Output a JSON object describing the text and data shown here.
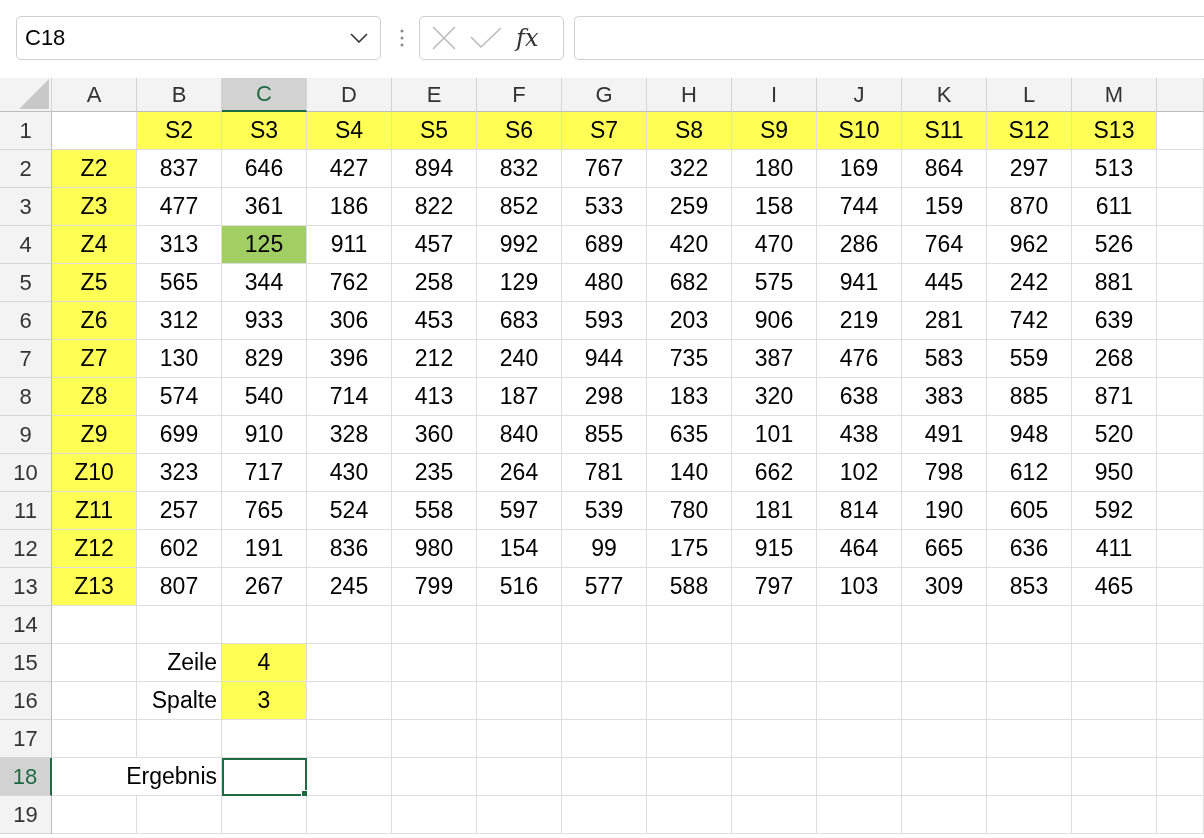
{
  "name_box": {
    "value": "C18"
  },
  "formula_bar": {
    "function_label": "fx"
  },
  "columns": [
    {
      "label": "A",
      "selected": false
    },
    {
      "label": "B",
      "selected": false
    },
    {
      "label": "C",
      "selected": true
    },
    {
      "label": "D",
      "selected": false
    },
    {
      "label": "E",
      "selected": false
    },
    {
      "label": "F",
      "selected": false
    },
    {
      "label": "G",
      "selected": false
    },
    {
      "label": "H",
      "selected": false
    },
    {
      "label": "I",
      "selected": false
    },
    {
      "label": "J",
      "selected": false
    },
    {
      "label": "K",
      "selected": false
    },
    {
      "label": "L",
      "selected": false
    },
    {
      "label": "M",
      "selected": false
    }
  ],
  "rows": [
    {
      "header": "1",
      "selected": false,
      "cells": [
        {
          "selected": false
        },
        {
          "text": "S2",
          "color": "#ffff55",
          "selected": false
        },
        {
          "text": "S3",
          "color": "#ffff55",
          "selected": false
        },
        {
          "text": "S4",
          "color": "#ffff55",
          "selected": false
        },
        {
          "text": "S5",
          "color": "#ffff55",
          "selected": false
        },
        {
          "text": "S6",
          "color": "#ffff55",
          "selected": false
        },
        {
          "text": "S7",
          "color": "#ffff55",
          "selected": false
        },
        {
          "text": "S8",
          "color": "#ffff55",
          "selected": false
        },
        {
          "text": "S9",
          "color": "#ffff55",
          "selected": false
        },
        {
          "text": "S10",
          "color": "#ffff55",
          "selected": false
        },
        {
          "text": "S11",
          "color": "#ffff55",
          "selected": false
        },
        {
          "text": "S12",
          "color": "#ffff55",
          "selected": false
        },
        {
          "text": "S13",
          "color": "#ffff55",
          "selected": false
        }
      ]
    },
    {
      "header": "2",
      "selected": false,
      "cells": [
        {
          "text": "Z2",
          "color": "#ffff55",
          "selected": false
        },
        {
          "text": "837",
          "selected": false
        },
        {
          "text": "646",
          "selected": false
        },
        {
          "text": "427",
          "selected": false
        },
        {
          "text": "894",
          "selected": false
        },
        {
          "text": "832",
          "selected": false
        },
        {
          "text": "767",
          "selected": false
        },
        {
          "text": "322",
          "selected": false
        },
        {
          "text": "180",
          "selected": false
        },
        {
          "text": "169",
          "selected": false
        },
        {
          "text": "864",
          "selected": false
        },
        {
          "text": "297",
          "selected": false
        },
        {
          "text": "513",
          "selected": false
        }
      ]
    },
    {
      "header": "3",
      "selected": false,
      "cells": [
        {
          "text": "Z3",
          "color": "#ffff55",
          "selected": false
        },
        {
          "text": "477",
          "selected": false
        },
        {
          "text": "361",
          "selected": false
        },
        {
          "text": "186",
          "selected": false
        },
        {
          "text": "822",
          "selected": false
        },
        {
          "text": "852",
          "selected": false
        },
        {
          "text": "533",
          "selected": false
        },
        {
          "text": "259",
          "selected": false
        },
        {
          "text": "158",
          "selected": false
        },
        {
          "text": "744",
          "selected": false
        },
        {
          "text": "159",
          "selected": false
        },
        {
          "text": "870",
          "selected": false
        },
        {
          "text": "611",
          "selected": false
        }
      ]
    },
    {
      "header": "4",
      "selected": false,
      "cells": [
        {
          "text": "Z4",
          "color": "#ffff55",
          "selected": false
        },
        {
          "text": "313",
          "selected": false
        },
        {
          "text": "125",
          "color": "#a2cf64",
          "selected": false
        },
        {
          "text": "911",
          "selected": false
        },
        {
          "text": "457",
          "selected": false
        },
        {
          "text": "992",
          "selected": false
        },
        {
          "text": "689",
          "selected": false
        },
        {
          "text": "420",
          "selected": false
        },
        {
          "text": "470",
          "selected": false
        },
        {
          "text": "286",
          "selected": false
        },
        {
          "text": "764",
          "selected": false
        },
        {
          "text": "962",
          "selected": false
        },
        {
          "text": "526",
          "selected": false
        }
      ]
    },
    {
      "header": "5",
      "selected": false,
      "cells": [
        {
          "text": "Z5",
          "color": "#ffff55",
          "selected": false
        },
        {
          "text": "565",
          "selected": false
        },
        {
          "text": "344",
          "selected": false
        },
        {
          "text": "762",
          "selected": false
        },
        {
          "text": "258",
          "selected": false
        },
        {
          "text": "129",
          "selected": false
        },
        {
          "text": "480",
          "selected": false
        },
        {
          "text": "682",
          "selected": false
        },
        {
          "text": "575",
          "selected": false
        },
        {
          "text": "941",
          "selected": false
        },
        {
          "text": "445",
          "selected": false
        },
        {
          "text": "242",
          "selected": false
        },
        {
          "text": "881",
          "selected": false
        }
      ]
    },
    {
      "header": "6",
      "selected": false,
      "cells": [
        {
          "text": "Z6",
          "color": "#ffff55",
          "selected": false
        },
        {
          "text": "312",
          "selected": false
        },
        {
          "text": "933",
          "selected": false
        },
        {
          "text": "306",
          "selected": false
        },
        {
          "text": "453",
          "selected": false
        },
        {
          "text": "683",
          "selected": false
        },
        {
          "text": "593",
          "selected": false
        },
        {
          "text": "203",
          "selected": false
        },
        {
          "text": "906",
          "selected": false
        },
        {
          "text": "219",
          "selected": false
        },
        {
          "text": "281",
          "selected": false
        },
        {
          "text": "742",
          "selected": false
        },
        {
          "text": "639",
          "selected": false
        }
      ]
    },
    {
      "header": "7",
      "selected": false,
      "cells": [
        {
          "text": "Z7",
          "color": "#ffff55",
          "selected": false
        },
        {
          "text": "130",
          "selected": false
        },
        {
          "text": "829",
          "selected": false
        },
        {
          "text": "396",
          "selected": false
        },
        {
          "text": "212",
          "selected": false
        },
        {
          "text": "240",
          "selected": false
        },
        {
          "text": "944",
          "selected": false
        },
        {
          "text": "735",
          "selected": false
        },
        {
          "text": "387",
          "selected": false
        },
        {
          "text": "476",
          "selected": false
        },
        {
          "text": "583",
          "selected": false
        },
        {
          "text": "559",
          "selected": false
        },
        {
          "text": "268",
          "selected": false
        }
      ]
    },
    {
      "header": "8",
      "selected": false,
      "cells": [
        {
          "text": "Z8",
          "color": "#ffff55",
          "selected": false
        },
        {
          "text": "574",
          "selected": false
        },
        {
          "text": "540",
          "selected": false
        },
        {
          "text": "714",
          "selected": false
        },
        {
          "text": "413",
          "selected": false
        },
        {
          "text": "187",
          "selected": false
        },
        {
          "text": "298",
          "selected": false
        },
        {
          "text": "183",
          "selected": false
        },
        {
          "text": "320",
          "selected": false
        },
        {
          "text": "638",
          "selected": false
        },
        {
          "text": "383",
          "selected": false
        },
        {
          "text": "885",
          "selected": false
        },
        {
          "text": "871",
          "selected": false
        }
      ]
    },
    {
      "header": "9",
      "selected": false,
      "cells": [
        {
          "text": "Z9",
          "color": "#ffff55",
          "selected": false
        },
        {
          "text": "699",
          "selected": false
        },
        {
          "text": "910",
          "selected": false
        },
        {
          "text": "328",
          "selected": false
        },
        {
          "text": "360",
          "selected": false
        },
        {
          "text": "840",
          "selected": false
        },
        {
          "text": "855",
          "selected": false
        },
        {
          "text": "635",
          "selected": false
        },
        {
          "text": "101",
          "selected": false
        },
        {
          "text": "438",
          "selected": false
        },
        {
          "text": "491",
          "selected": false
        },
        {
          "text": "948",
          "selected": false
        },
        {
          "text": "520",
          "selected": false
        }
      ]
    },
    {
      "header": "10",
      "selected": false,
      "cells": [
        {
          "text": "Z10",
          "color": "#ffff55",
          "selected": false
        },
        {
          "text": "323",
          "selected": false
        },
        {
          "text": "717",
          "selected": false
        },
        {
          "text": "430",
          "selected": false
        },
        {
          "text": "235",
          "selected": false
        },
        {
          "text": "264",
          "selected": false
        },
        {
          "text": "781",
          "selected": false
        },
        {
          "text": "140",
          "selected": false
        },
        {
          "text": "662",
          "selected": false
        },
        {
          "text": "102",
          "selected": false
        },
        {
          "text": "798",
          "selected": false
        },
        {
          "text": "612",
          "selected": false
        },
        {
          "text": "950",
          "selected": false
        }
      ]
    },
    {
      "header": "11",
      "selected": false,
      "cells": [
        {
          "text": "Z11",
          "color": "#ffff55",
          "selected": false
        },
        {
          "text": "257",
          "selected": false
        },
        {
          "text": "765",
          "selected": false
        },
        {
          "text": "524",
          "selected": false
        },
        {
          "text": "558",
          "selected": false
        },
        {
          "text": "597",
          "selected": false
        },
        {
          "text": "539",
          "selected": false
        },
        {
          "text": "780",
          "selected": false
        },
        {
          "text": "181",
          "selected": false
        },
        {
          "text": "814",
          "selected": false
        },
        {
          "text": "190",
          "selected": false
        },
        {
          "text": "605",
          "selected": false
        },
        {
          "text": "592",
          "selected": false
        }
      ]
    },
    {
      "header": "12",
      "selected": false,
      "cells": [
        {
          "text": "Z12",
          "color": "#ffff55",
          "selected": false
        },
        {
          "text": "602",
          "selected": false
        },
        {
          "text": "191",
          "selected": false
        },
        {
          "text": "836",
          "selected": false
        },
        {
          "text": "980",
          "selected": false
        },
        {
          "text": "154",
          "selected": false
        },
        {
          "text": "99",
          "selected": false
        },
        {
          "text": "175",
          "selected": false
        },
        {
          "text": "915",
          "selected": false
        },
        {
          "text": "464",
          "selected": false
        },
        {
          "text": "665",
          "selected": false
        },
        {
          "text": "636",
          "selected": false
        },
        {
          "text": "411",
          "selected": false
        }
      ]
    },
    {
      "header": "13",
      "selected": false,
      "cells": [
        {
          "text": "Z13",
          "color": "#ffff55",
          "selected": false
        },
        {
          "text": "807",
          "selected": false
        },
        {
          "text": "267",
          "selected": false
        },
        {
          "text": "245",
          "selected": false
        },
        {
          "text": "799",
          "selected": false
        },
        {
          "text": "516",
          "selected": false
        },
        {
          "text": "577",
          "selected": false
        },
        {
          "text": "588",
          "selected": false
        },
        {
          "text": "797",
          "selected": false
        },
        {
          "text": "103",
          "selected": false
        },
        {
          "text": "309",
          "selected": false
        },
        {
          "text": "853",
          "selected": false
        },
        {
          "text": "465",
          "selected": false
        }
      ]
    },
    {
      "header": "14",
      "selected": false,
      "cells": [
        {
          "selected": false
        },
        {
          "selected": false
        },
        {
          "selected": false
        },
        {
          "selected": false
        },
        {
          "selected": false
        },
        {
          "selected": false
        },
        {
          "selected": false
        },
        {
          "selected": false
        },
        {
          "selected": false
        },
        {
          "selected": false
        },
        {
          "selected": false
        },
        {
          "selected": false
        },
        {
          "selected": false
        }
      ]
    },
    {
      "header": "15",
      "selected": false,
      "cells": [
        {
          "selected": false
        },
        {
          "text": "Zeile",
          "kind": "label",
          "selected": false
        },
        {
          "text": "4",
          "color": "#ffff55",
          "selected": false
        },
        {
          "selected": false
        },
        {
          "selected": false
        },
        {
          "selected": false
        },
        {
          "selected": false
        },
        {
          "selected": false
        },
        {
          "selected": false
        },
        {
          "selected": false
        },
        {
          "selected": false
        },
        {
          "selected": false
        },
        {
          "selected": false
        }
      ]
    },
    {
      "header": "16",
      "selected": false,
      "cells": [
        {
          "selected": false
        },
        {
          "text": "Spalte",
          "kind": "label",
          "selected": false
        },
        {
          "text": "3",
          "color": "#ffff55",
          "selected": false
        },
        {
          "selected": false
        },
        {
          "selected": false
        },
        {
          "selected": false
        },
        {
          "selected": false
        },
        {
          "selected": false
        },
        {
          "selected": false
        },
        {
          "selected": false
        },
        {
          "selected": false
        },
        {
          "selected": false
        },
        {
          "selected": false
        }
      ]
    },
    {
      "header": "17",
      "selected": false,
      "cells": [
        {
          "selected": false
        },
        {
          "selected": false
        },
        {
          "selected": false
        },
        {
          "selected": false
        },
        {
          "selected": false
        },
        {
          "selected": false
        },
        {
          "selected": false
        },
        {
          "selected": false
        },
        {
          "selected": false
        },
        {
          "selected": false
        },
        {
          "selected": false
        },
        {
          "selected": false
        },
        {
          "selected": false
        }
      ]
    },
    {
      "header": "18",
      "selected": true,
      "cells": [
        {
          "selected": false
        },
        {
          "text": "Ergebnis",
          "kind": "overflow_label",
          "selected": false
        },
        {
          "selected": true
        },
        {
          "selected": false
        },
        {
          "selected": false
        },
        {
          "selected": false
        },
        {
          "selected": false
        },
        {
          "selected": false
        },
        {
          "selected": false
        },
        {
          "selected": false
        },
        {
          "selected": false
        },
        {
          "selected": false
        },
        {
          "selected": false
        }
      ]
    },
    {
      "header": "19",
      "selected": false,
      "cells": [
        {
          "selected": false
        },
        {
          "selected": false
        },
        {
          "selected": false
        },
        {
          "selected": false
        },
        {
          "selected": false
        },
        {
          "selected": false
        },
        {
          "selected": false
        },
        {
          "selected": false
        },
        {
          "selected": false
        },
        {
          "selected": false
        },
        {
          "selected": false
        },
        {
          "selected": false
        },
        {
          "selected": false
        }
      ]
    }
  ]
}
